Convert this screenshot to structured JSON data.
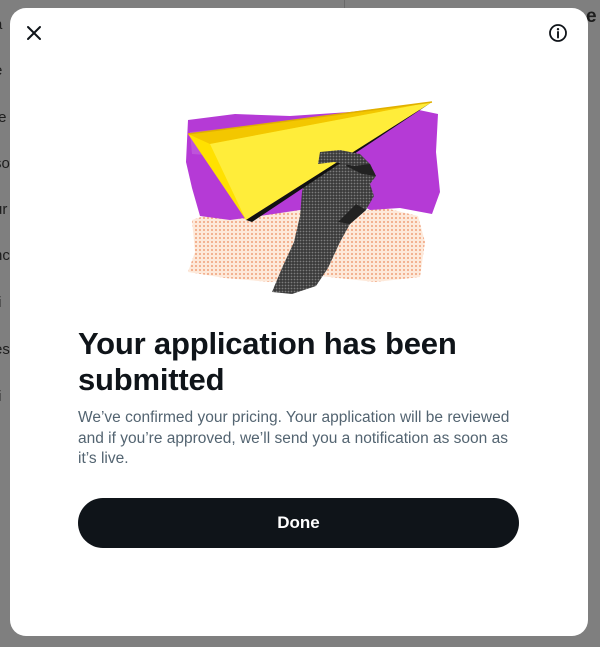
{
  "background": {
    "left_menu_fragments": [
      "a",
      "e",
      "te",
      "so",
      "ur",
      "nc",
      "fi",
      "es",
      "ti"
    ],
    "right_header_fragment": "e"
  },
  "dialog": {
    "title": "Your application has been submitted",
    "description": "We’ve confirmed your pricing. Your application will be reviewed and if you’re approved, we’ll send you a notification as soon as it’s live.",
    "done_label": "Done",
    "close_icon": "close-icon",
    "info_icon": "info-icon",
    "illustration": "hand-holding-paper-airplane"
  },
  "colors": {
    "button_bg": "#0f1419",
    "title": "#0f1419",
    "body_text": "#536471",
    "overlay": "#7f7f7f",
    "airplane": "#ffe100",
    "purple": "#b53ad6",
    "peach": "#f5c8a8"
  }
}
